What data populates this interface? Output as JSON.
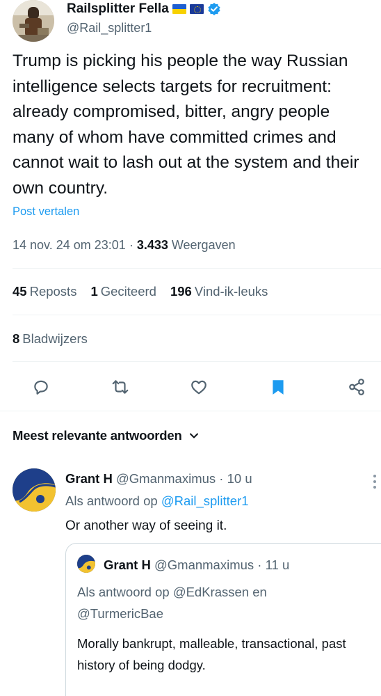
{
  "author": {
    "name": "Railsplitter Fella",
    "handle": "@Rail_splitter1"
  },
  "tweet": {
    "text": "Trump is picking his people the way Russian intelligence selects targets for recruitment: already compromised, bitter, angry people many of whom have committed crimes and cannot wait to lash out at the system and their own country.",
    "translate_label": "Post vertalen",
    "timestamp": "14 nov. 24 om 23:01",
    "views_count": "3.433",
    "views_label": "Weergaven"
  },
  "stats": {
    "reposts_count": "45",
    "reposts_label": "Reposts",
    "quotes_count": "1",
    "quotes_label": "Geciteerd",
    "likes_count": "196",
    "likes_label": "Vind-ik-leuks",
    "bookmarks_count": "8",
    "bookmarks_label": "Bladwijzers"
  },
  "actions": {
    "icons": [
      "reply-icon",
      "repost-icon",
      "like-icon",
      "bookmark-icon",
      "share-icon"
    ],
    "bookmark_color": "#1d9bf0"
  },
  "replies_header": {
    "label": "Meest relevante antwoorden"
  },
  "reply": {
    "name": "Grant H",
    "handle": "@Gmanmaximus",
    "time": "10 u",
    "replying_prefix": "Als antwoord op",
    "replying_to": "@Rail_splitter1",
    "text": "Or another way of seeing it."
  },
  "quote": {
    "name": "Grant H",
    "handle": "@Gmanmaximus",
    "time": "11 u",
    "replying_prefix": "Als antwoord op",
    "replying_to_1": "@EdKrassen",
    "replying_join": "en",
    "replying_to_2": "@TurmericBae",
    "text": "Morally bankrupt, malleable, transactional, past history of being dodgy."
  },
  "colors": {
    "accent": "#1d9bf0",
    "muted": "#536471",
    "text": "#0f1419",
    "divider": "#eff3f4"
  }
}
